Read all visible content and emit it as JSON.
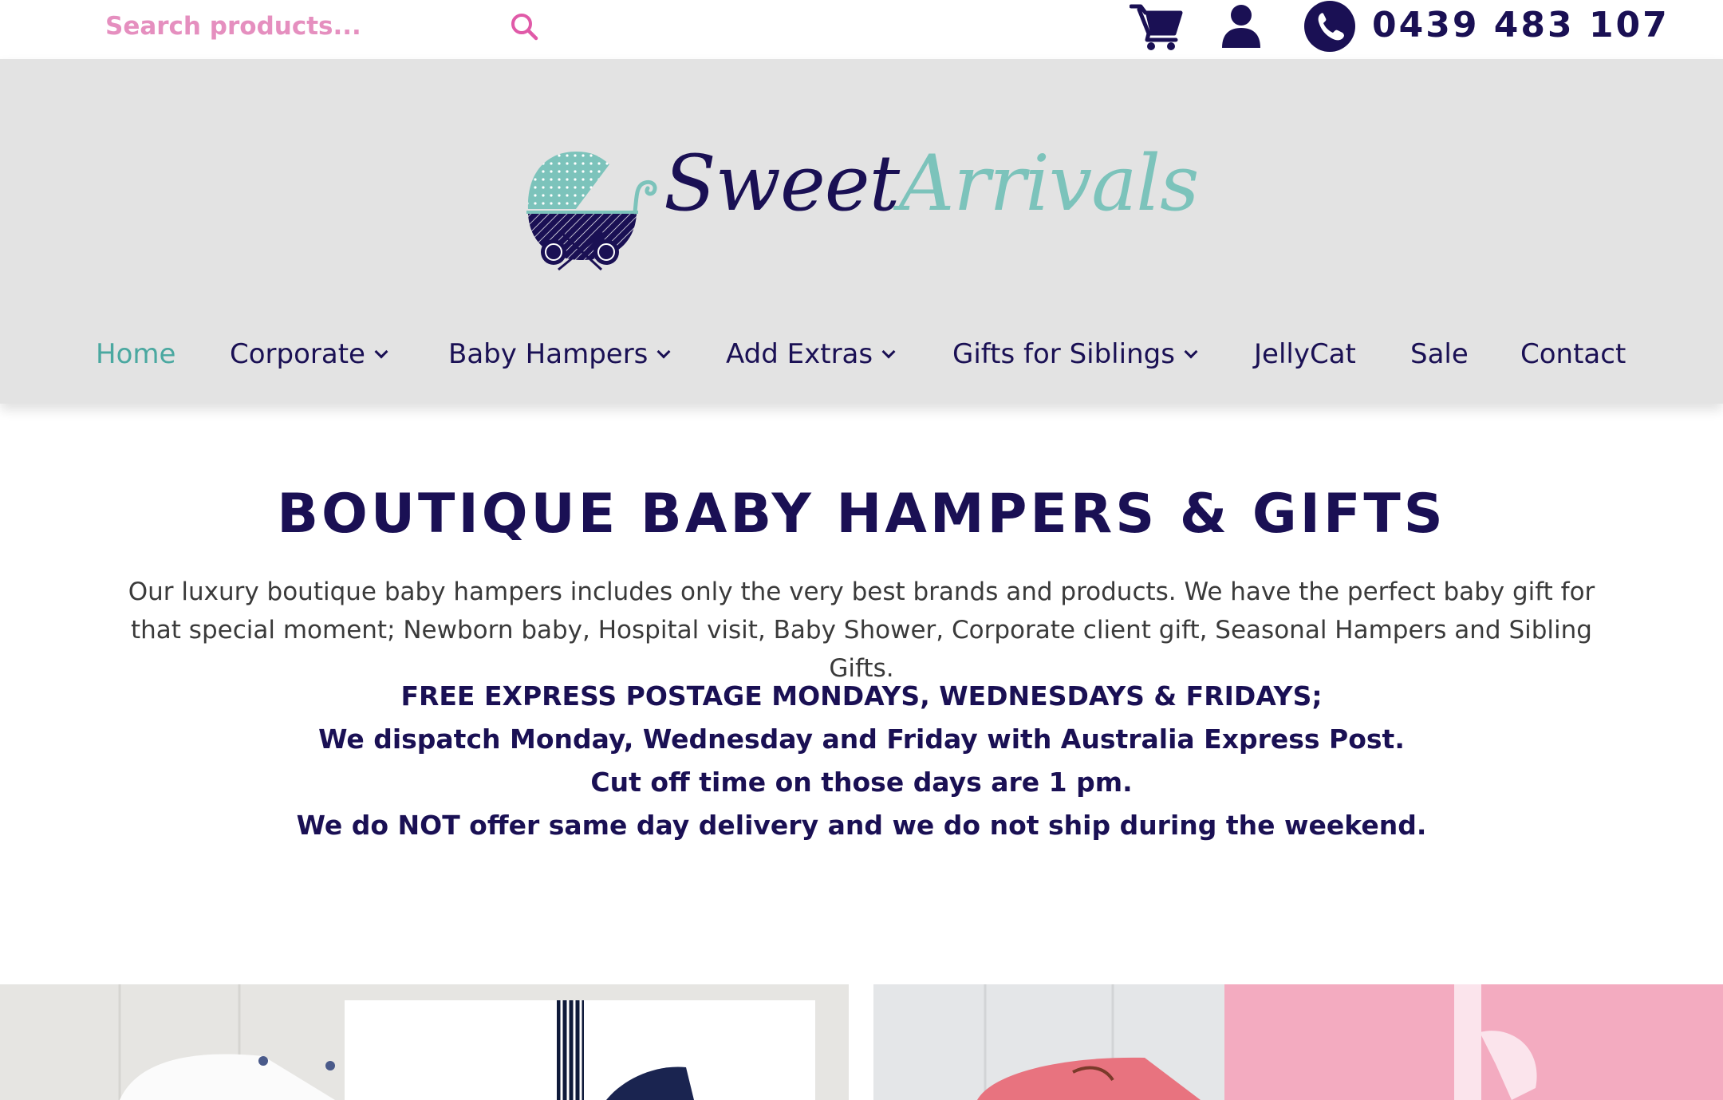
{
  "search": {
    "placeholder": "Search products..."
  },
  "topbar": {
    "phone": "0439 483 107"
  },
  "logo": {
    "word1": "Sweet",
    "word2": "Arrivals"
  },
  "nav": {
    "items": [
      {
        "label": "Home"
      },
      {
        "label": "Corporate"
      },
      {
        "label": "Baby Hampers"
      },
      {
        "label": "Add Extras"
      },
      {
        "label": "Gifts for Siblings"
      },
      {
        "label": "JellyCat"
      },
      {
        "label": "Sale"
      },
      {
        "label": "Contact"
      }
    ]
  },
  "intro": {
    "title": "BOUTIQUE BABY HAMPERS & GIFTS",
    "body": "Our luxury boutique baby hampers includes only the very best brands and products. We have the perfect baby gift for that special moment; Newborn baby, Hospital visit, Baby Shower, Corporate client gift, Seasonal Hampers and Sibling Gifts.",
    "notice": [
      "FREE EXPRESS POSTAGE MONDAYS, WEDNESDAYS & FRIDAYS;",
      "We dispatch Monday, Wednesday and Friday with Australia Express Post.",
      "Cut off time on those days are 1 pm.",
      "We do NOT offer same day delivery and we do not ship during the weekend."
    ]
  },
  "colors": {
    "navy": "#1a1054",
    "teal": "#7cc3bb",
    "pink": "#e58fbf",
    "header_bg": "#e3e3e3"
  }
}
